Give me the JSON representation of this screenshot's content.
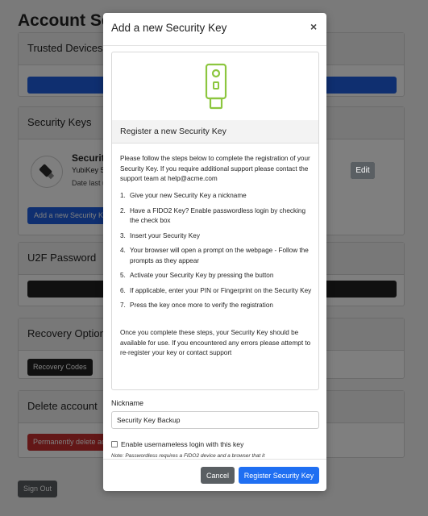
{
  "background": {
    "page_title": "Account Secu",
    "sections": {
      "trusted_devices": {
        "title": "Trusted Devices"
      },
      "security_keys": {
        "title": "Security Keys",
        "key_name": "Security",
        "key_model": "YubiKey 5",
        "key_date": "Date last u",
        "edit_label": "Edit",
        "add_label": "Add a new Security Ke"
      },
      "u2f": {
        "title": "U2F Password"
      },
      "recovery": {
        "title": "Recovery Options",
        "button_label": "Recovery Codes"
      },
      "delete": {
        "title": "Delete account",
        "button_label": "Permanently delete ac"
      }
    },
    "sign_out_label": "Sign Out"
  },
  "modal": {
    "title": "Add a new Security Key",
    "close_glyph": "×",
    "card_title": "Register a new Security Key",
    "intro": "Please follow the steps below to complete the registration of your Security Key. If you require additional support please contact the support team at help@acme.com",
    "steps": [
      "Give your new Security Key a nickname",
      "Have a FIDO2 Key? Enable passwordless login by checking the check box",
      "Insert your Security Key",
      "Your browser will open a prompt on the webpage - Follow the prompts as they appear",
      "Activate your Security Key by pressing the button",
      "If applicable, enter your PIN or Fingerprint on the Security Key",
      "Press the key once more to verify the registration"
    ],
    "outro": "Once you complete these steps, your Security Key should be available for use. If you encountered any errors please attempt to re-register your key or contact support",
    "nickname_label": "Nickname",
    "nickname_value": "Security Key Backup",
    "checkbox_label": "Enable usernameless login with this key",
    "checkbox_note": "Note: Passwordless requires a FIDO2 device and a browser that it",
    "cancel_label": "Cancel",
    "register_label": "Register Security Key"
  },
  "colors": {
    "accent": "#1f6ff2",
    "key_icon": "#8cc63f",
    "danger": "#c62f2f"
  }
}
